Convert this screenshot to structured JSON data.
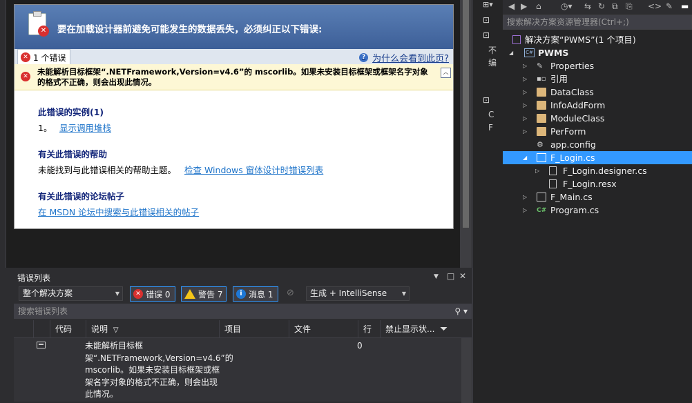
{
  "designer": {
    "header_title": "要在加载设计器前避免可能发生的数据丢失，必须纠正以下错误:",
    "error_tab_label": "1 个错误",
    "why_link": "为什么会看到此页?",
    "error_message": "未能解析目标框架“.NETFramework,Version=v4.6”的 mscorlib。如果未安装目标框架或框架名字对象的格式不正确，则会出现此情况。",
    "instances_heading": "此错误的实例(1)",
    "instance_number": "1。",
    "call_stack_link": "显示调用堆栈",
    "help_heading": "有关此错误的帮助",
    "help_text": "未能找到与此错误相关的帮助主题。",
    "help_link": "检查 Windows 窗体设计时错误列表",
    "forum_heading": "有关此错误的论坛帖子",
    "forum_link": "在 MSDN 论坛中搜索与此错误相关的帖子"
  },
  "error_list": {
    "title": "错误列表",
    "scope": "整个解决方案",
    "errors_btn": "错误 0",
    "warnings_btn": "警告 7",
    "messages_btn": "消息 1",
    "build_combo": "生成 + IntelliSense",
    "search_placeholder": "搜索错误列表",
    "columns": [
      "代码",
      "说明",
      "项目",
      "文件",
      "行",
      "禁止显示状..."
    ],
    "rows": [
      {
        "code": "",
        "description": "未能解析目标框架“.NETFramework,Version=v4.6”的 mscorlib。如果未安装目标框架或框架名字对象的格式不正确，则会出现此情况。",
        "project": "",
        "file": "",
        "line": "0",
        "suppression": ""
      }
    ]
  },
  "middle_strip": [
    "不",
    "编",
    "C",
    "F"
  ],
  "solution_explorer": {
    "search_placeholder": "搜索解决方案资源管理器(Ctrl+;)",
    "solution": "解决方案“PWMS”(1 个项目)",
    "project": "PWMS",
    "items": [
      {
        "label": "Properties",
        "icon": "wrench-icon"
      },
      {
        "label": "引用",
        "icon": "references-icon"
      },
      {
        "label": "DataClass",
        "icon": "folder-icon"
      },
      {
        "label": "InfoAddForm",
        "icon": "folder-icon"
      },
      {
        "label": "ModuleClass",
        "icon": "folder-icon"
      },
      {
        "label": "PerForm",
        "icon": "folder-icon"
      },
      {
        "label": "app.config",
        "icon": "config-icon"
      },
      {
        "label": "F_Login.cs",
        "icon": "form-icon"
      },
      {
        "label": "F_Login.designer.cs",
        "icon": "cs-file-icon"
      },
      {
        "label": "F_Login.resx",
        "icon": "resx-icon"
      },
      {
        "label": "F_Main.cs",
        "icon": "form-icon"
      },
      {
        "label": "Program.cs",
        "icon": "csharp-icon"
      }
    ]
  },
  "colors": {
    "accent": "#3399ff",
    "error": "#d9302f",
    "warning": "#f5c518",
    "link": "#1d73c9"
  }
}
